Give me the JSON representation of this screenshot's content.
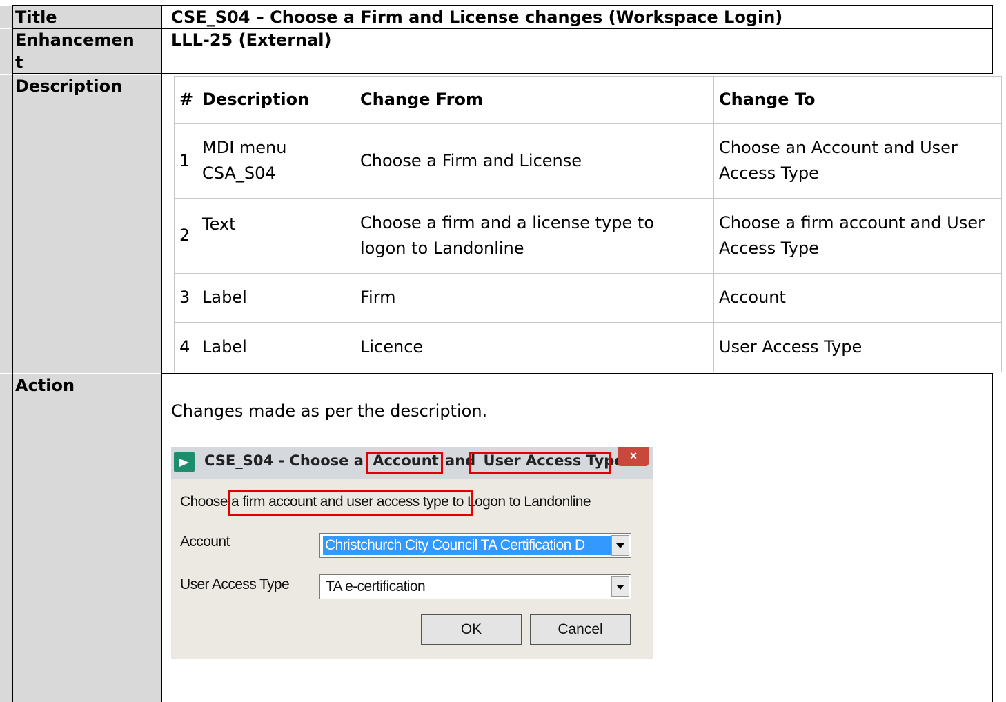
{
  "labels": {
    "title": "Title",
    "enhancement": "Enhancemen\nt",
    "description": "Description",
    "action": "Action"
  },
  "values": {
    "title": "CSE_S04 – Choose a Firm and License changes (Workspace Login)",
    "enhancement": "LLL-25 (External)"
  },
  "changes_table": {
    "headers": [
      "#",
      "Description",
      "Change From",
      "Change To"
    ],
    "rows": [
      [
        "1",
        "MDI menu CSA_S04",
        "Choose a Firm and License",
        "Choose an Account and User Access Type"
      ],
      [
        "2",
        "Text",
        "Choose a firm and a license type to logon to Landonline",
        "Choose a firm account and User Access Type"
      ],
      [
        "3",
        "Label",
        "Firm",
        "Account"
      ],
      [
        "4",
        "Label",
        "Licence",
        "User Access Type"
      ]
    ]
  },
  "action_text": "Changes made as per the description.",
  "dialog": {
    "title_part1": "CSE_S04 - Choose a",
    "title_account": "Account",
    "title_and": "and",
    "title_uat": "User Access Type",
    "close": "×",
    "prompt_start": "Choose",
    "prompt_highlight": "a firm account and user access type",
    "prompt_end": "to Logon to Landonline",
    "account_label": "Account",
    "account_value": "Christchurch City Council TA Certification D",
    "uat_label": "User Access Type",
    "uat_value": "TA e-certification",
    "ok": "OK",
    "cancel": "Cancel"
  },
  "colors": {
    "label_bg": "#d9d9d9",
    "highlight": "#e00000",
    "selection": "#3399ff"
  }
}
